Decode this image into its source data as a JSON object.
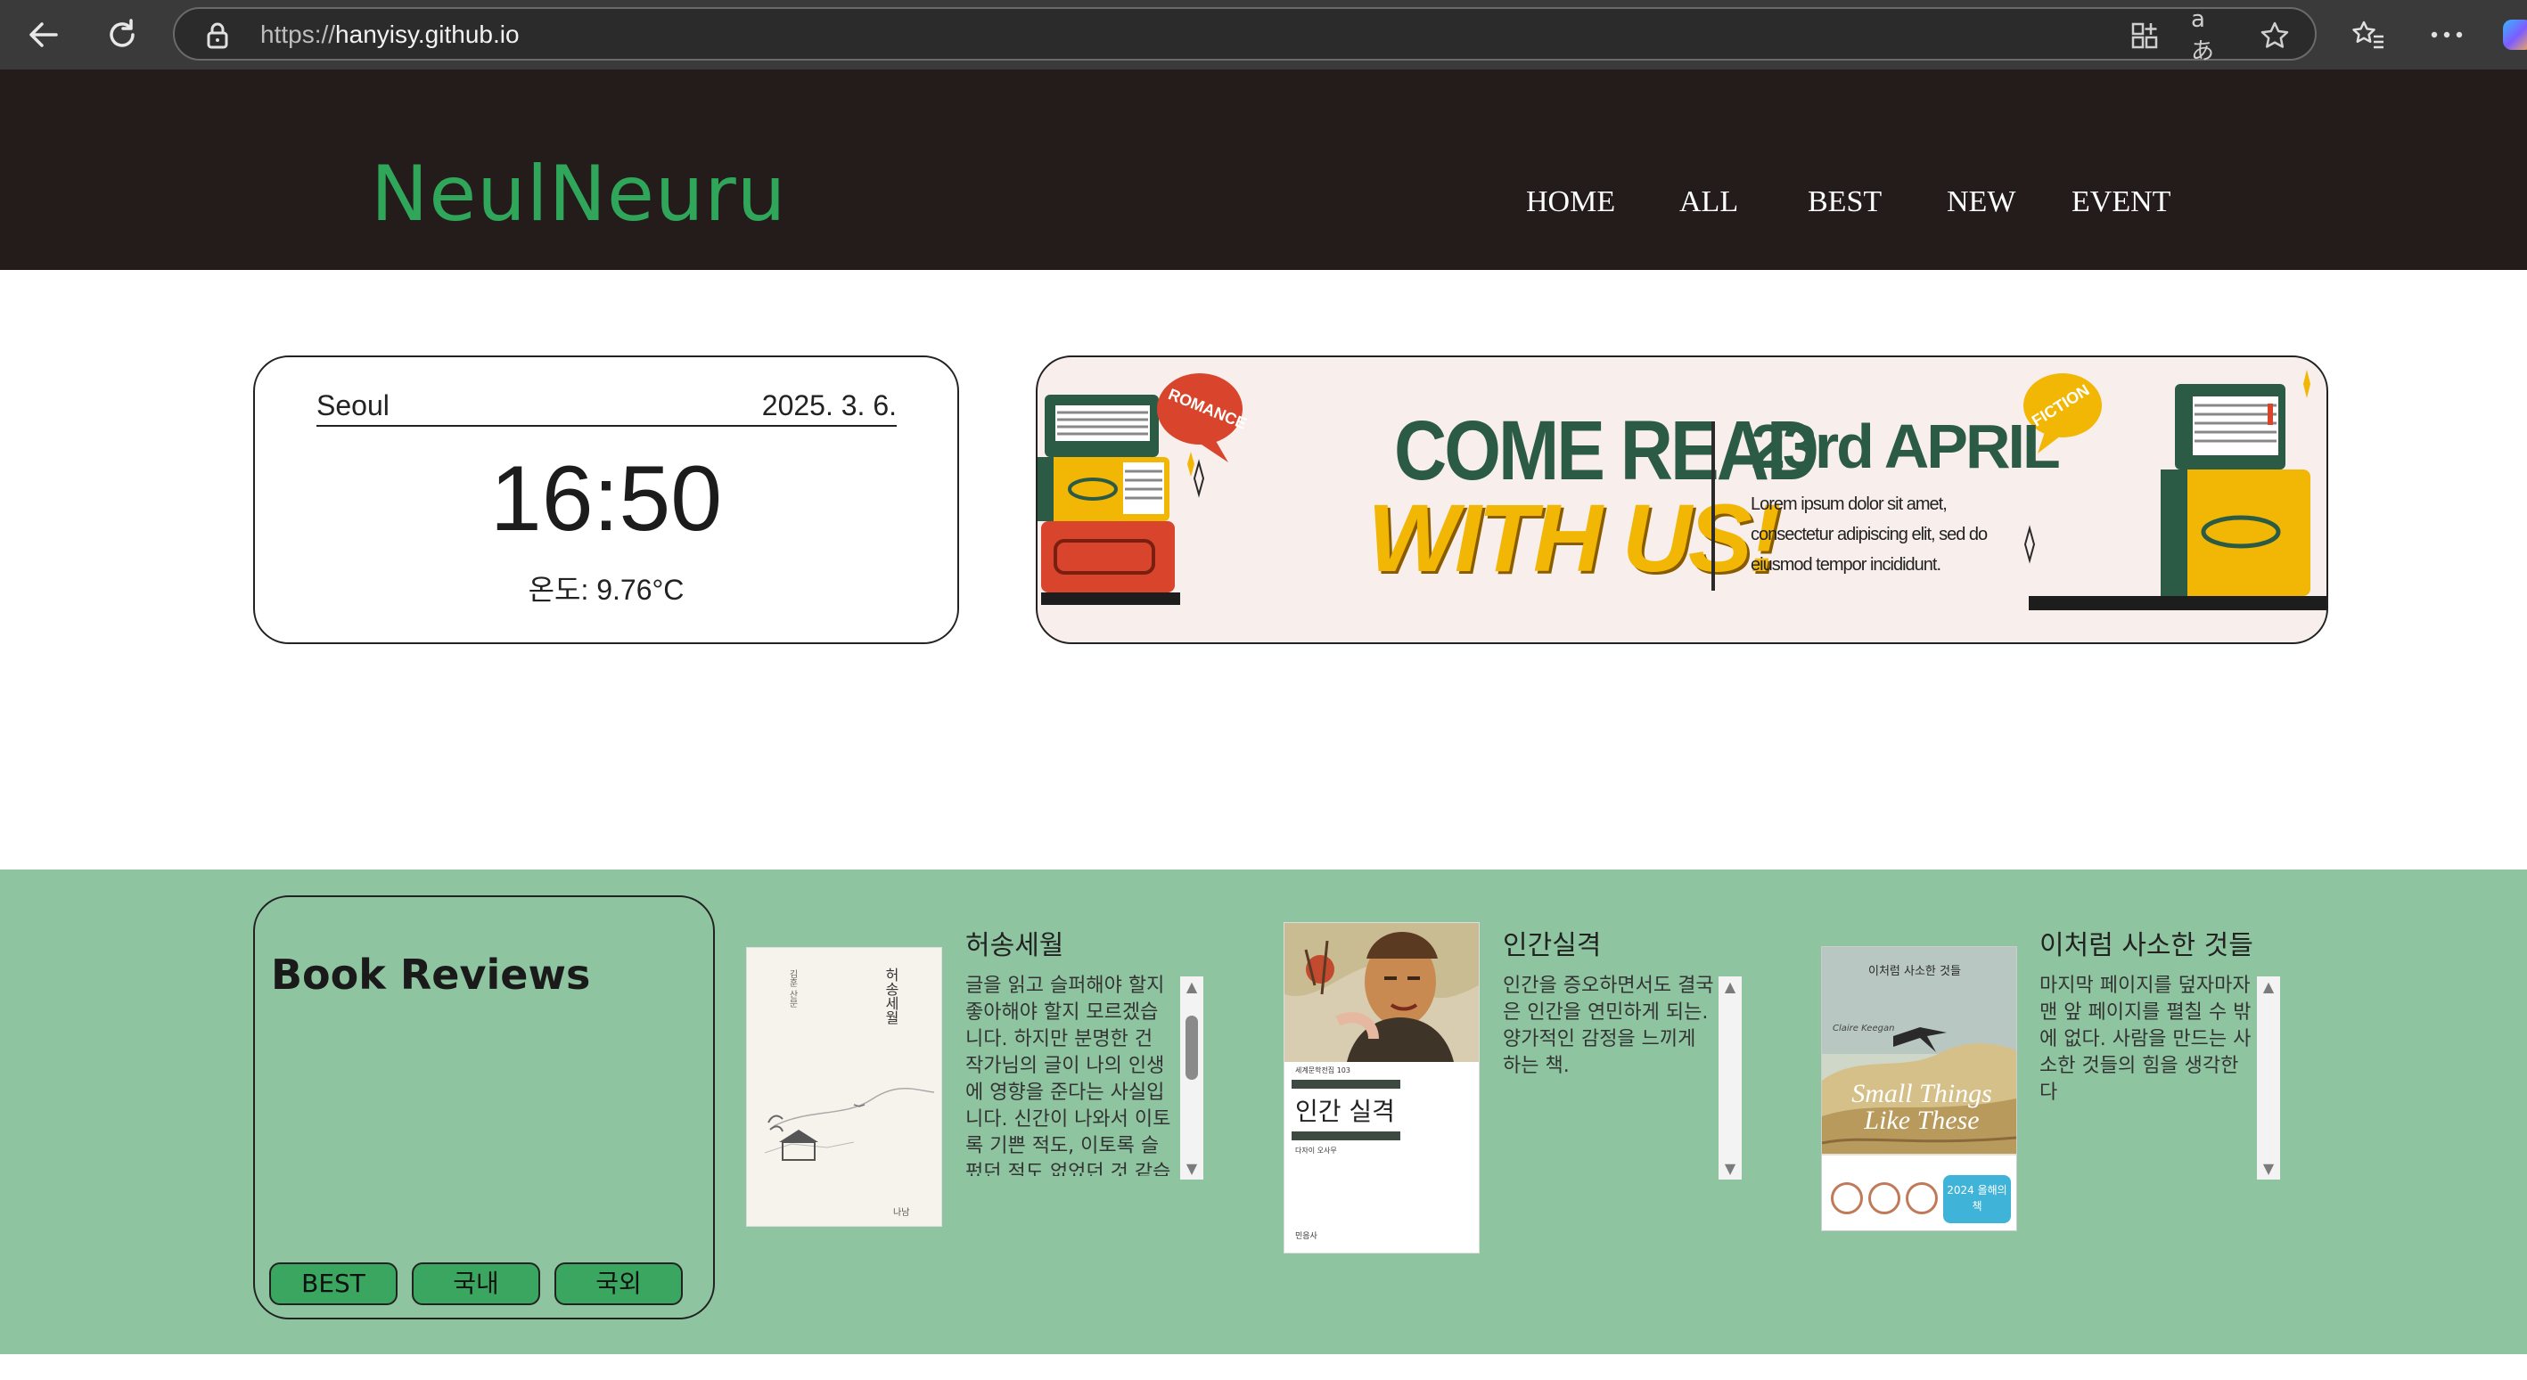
{
  "browser": {
    "url_prefix": "https://",
    "url_host": "hanyisy.github.io",
    "icons": [
      "back-icon",
      "refresh-icon",
      "lock-icon",
      "app-icon",
      "translate-icon",
      "star-icon",
      "favorites-icon",
      "more-icon"
    ],
    "translate_label": "aあ"
  },
  "header": {
    "logo": "NeulNeuru",
    "menu": [
      "HOME",
      "ALL",
      "BEST",
      "NEW",
      "EVENT"
    ]
  },
  "weather": {
    "city": "Seoul",
    "date": "2025. 3. 6.",
    "time": "16:50",
    "temperature": "온도: 9.76°C"
  },
  "banner": {
    "romance_tag": "ROMANCE",
    "headline_line1": "COME READ",
    "headline_line2": "WITH US!",
    "event_date": "23rd APRIL",
    "body": "Lorem ipsum dolor sit amet, consectetur adipiscing elit, sed do eiusmod tempor incididunt.",
    "fiction_tag": "FICTION",
    "colors": {
      "green": "#2c5b45",
      "yellow": "#f2b705",
      "red": "#d9442c",
      "background": "#f8eeec"
    }
  },
  "reviews": {
    "title": "Book Reviews",
    "filters": [
      "BEST",
      "국내",
      "국외"
    ],
    "books": [
      {
        "title": "허송세월",
        "review": "글을 읽고 슬퍼해야 할지 좋아해야 할지 모르겠습니다. 하지만 분명한 건 작가님의 글이 나의 인생에 영향을 준다는 사실입니다. 신간이 나와서 이토록 기쁜 적도, 이토록 슬펐던 적도 없었던 것 같습니다. 감",
        "cover_title": "허송세월",
        "cover_author": "김훈 산문",
        "cover_publisher": "나남",
        "scroll_position": 0.25
      },
      {
        "title": "인간실격",
        "review": "인간을 증오하면서도 결국은 인간을 연민하게 되는. 양가적인 감정을 느끼게 하는 책.",
        "cover_title": "인간 실격",
        "cover_series": "세계문학전집 103",
        "cover_author": "다자이 오사무",
        "cover_publisher": "민음사"
      },
      {
        "title": "이처럼 사소한 것들",
        "review": "마지막 페이지를 덮자마자 맨 앞 페이지를 펼칠 수 밖에 없다. 사람을 만드는 사소한 것들의 힘을 생각한다",
        "cover_title_ko": "이처럼 사소한 것들",
        "cover_author": "Claire Keegan",
        "cover_title_en": "Small Things Like These",
        "cover_badge": "2024 올해의 책"
      }
    ]
  }
}
